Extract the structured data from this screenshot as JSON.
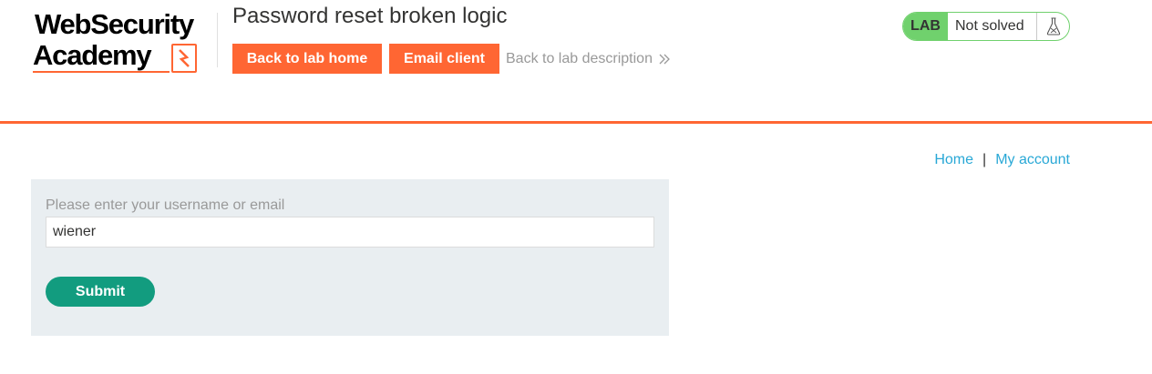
{
  "header": {
    "logo": {
      "line1": "WebSecurity",
      "line2": "Academy"
    },
    "title": "Password reset broken logic",
    "buttons": {
      "back_home": "Back to lab home",
      "email_client": "Email client"
    },
    "desc_link": "Back to lab description",
    "lab": {
      "tag": "LAB",
      "status": "Not solved",
      "icon": "flask-icon"
    }
  },
  "nav": {
    "home": "Home",
    "separator": "|",
    "account": "My account"
  },
  "form": {
    "label": "Please enter your username or email",
    "input_value": "wiener",
    "submit": "Submit"
  },
  "colors": {
    "accent": "#ff6633",
    "lab_green": "#70d16d",
    "submit_green": "#129c7f",
    "link_blue": "#29a8d6",
    "panel_bg": "#e9eef1"
  }
}
